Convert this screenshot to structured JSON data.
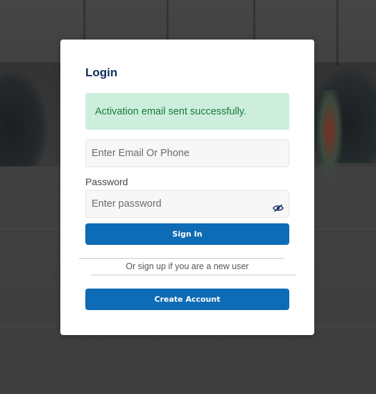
{
  "login": {
    "title": "Login",
    "alert": "Activation email sent successfully.",
    "email": {
      "placeholder": "Enter Email Or Phone",
      "value": ""
    },
    "password": {
      "label": "Password",
      "placeholder": "Enter password",
      "value": ""
    },
    "signin_label": "Sign In",
    "divider_text": "Or sign up if you are a new user",
    "create_label": "Create Account"
  },
  "icons": {
    "password_toggle": "eye-slash-icon"
  },
  "colors": {
    "primary": "#0e6bb5",
    "title": "#0f2c5c",
    "alert_bg": "#cdeedc",
    "alert_text": "#167a3c"
  }
}
